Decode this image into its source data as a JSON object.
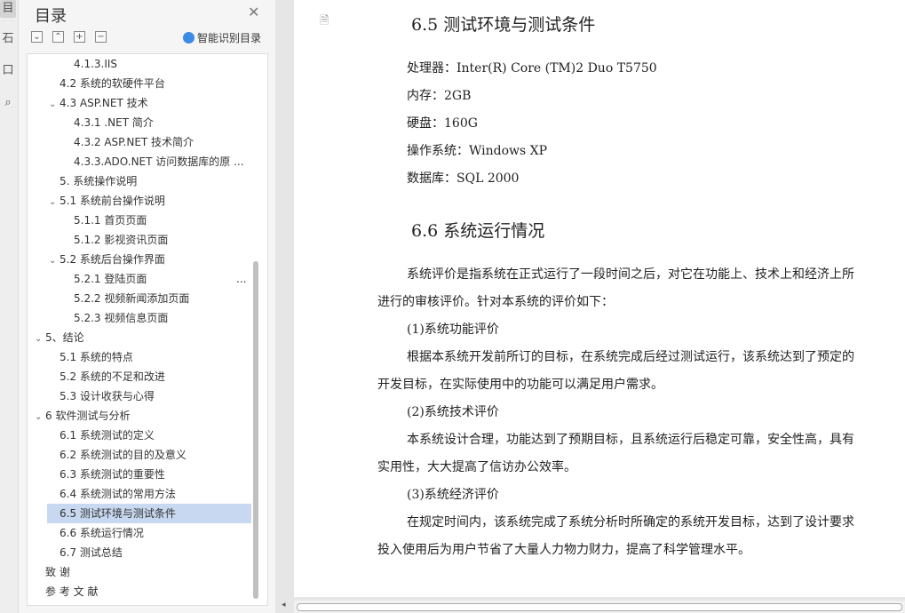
{
  "rail": {
    "items": [
      {
        "glyph": "目",
        "active": true
      },
      {
        "glyph": "石",
        "active": false
      },
      {
        "glyph": "口",
        "active": false
      },
      {
        "glyph": "⌕",
        "active": false
      }
    ]
  },
  "toc": {
    "title": "目录",
    "close_glyph": "✕",
    "smart_label": "智能识别目录",
    "tools": [
      "⌄",
      "⌃",
      "+",
      "−"
    ],
    "items": [
      {
        "label": "4.1.3.IIS",
        "level": 3,
        "chevron": ""
      },
      {
        "label": "4.2 系统的软硬件平台",
        "level": 2,
        "chevron": ""
      },
      {
        "label": "4.3 ASP.NET 技术",
        "level": 2,
        "chevron": "⌄"
      },
      {
        "label": "4.3.1 .NET 简介",
        "level": 3,
        "chevron": ""
      },
      {
        "label": "4.3.2 ASP.NET 技术简介",
        "level": 3,
        "chevron": ""
      },
      {
        "label": "4.3.3.ADO.NET 访问数据库的原 ...",
        "level": 3,
        "chevron": ""
      },
      {
        "label": "5.  系统操作说明",
        "level": 2,
        "chevron": ""
      },
      {
        "label": "5.1 系统前台操作说明",
        "level": 2,
        "chevron": "⌄"
      },
      {
        "label": "5.1.1 首页页面",
        "level": 3,
        "chevron": ""
      },
      {
        "label": "5.1.2 影视资讯页面",
        "level": 3,
        "chevron": ""
      },
      {
        "label": "5.2 系统后台操作界面",
        "level": 2,
        "chevron": "⌄"
      },
      {
        "label": "5.2.1 登陆页面",
        "level": 3,
        "chevron": "",
        "more": "..."
      },
      {
        "label": "5.2.2 视频新闻添加页面",
        "level": 3,
        "chevron": ""
      },
      {
        "label": "5.2.3 视频信息页面",
        "level": 3,
        "chevron": ""
      },
      {
        "label": "5、结论",
        "level": 1,
        "chevron": "⌄"
      },
      {
        "label": "5.1 系统的特点",
        "level": 2,
        "chevron": ""
      },
      {
        "label": "5.2 系统的不足和改进",
        "level": 2,
        "chevron": ""
      },
      {
        "label": "5.3 设计收获与心得",
        "level": 2,
        "chevron": ""
      },
      {
        "label": "6 软件测试与分析",
        "level": 1,
        "chevron": "⌄"
      },
      {
        "label": "6.1 系统测试的定义",
        "level": 2,
        "chevron": ""
      },
      {
        "label": "6.2 系统测试的目的及意义",
        "level": 2,
        "chevron": ""
      },
      {
        "label": "6.3 系统测试的重要性",
        "level": 2,
        "chevron": ""
      },
      {
        "label": "6.4 系统测试的常用方法",
        "level": 2,
        "chevron": ""
      },
      {
        "label": "6.5 测试环境与测试条件",
        "level": 2,
        "chevron": "",
        "selected": true
      },
      {
        "label": "6.6 系统运行情况",
        "level": 2,
        "chevron": ""
      },
      {
        "label": "6.7 测试总结",
        "level": 2,
        "chevron": ""
      },
      {
        "label": "致    谢",
        "level": 1,
        "chevron": ""
      },
      {
        "label": "参 考 文 献",
        "level": 1,
        "chevron": ""
      }
    ]
  },
  "document": {
    "icon_glyph": "🗎",
    "heading1": "6.5 测试环境与测试条件",
    "specs": [
      "处理器：Inter(R) Core (TM)2 Duo T5750",
      "内存：2GB",
      "硬盘：160G",
      "操作系统：Windows XP",
      "数据库：SQL 2000"
    ],
    "heading2": "6.6 系统运行情况",
    "body": [
      {
        "text": "系统评价是指系统在正式运行了一段时间之后，对它在功能上、技术上和经济上所",
        "indent": true
      },
      {
        "text": "进行的审核评价。针对本系统的评价如下：",
        "indent": false
      },
      {
        "text": "(1)系统功能评价",
        "indent": true
      },
      {
        "text": "根据本系统开发前所订的目标，在系统完成后经过测试运行，该系统达到了预定的",
        "indent": true
      },
      {
        "text": "开发目标，在实际使用中的功能可以满足用户需求。",
        "indent": false
      },
      {
        "text": "(2)系统技术评价",
        "indent": true
      },
      {
        "text": "本系统设计合理，功能达到了预期目标，且系统运行后稳定可靠，安全性高，具有",
        "indent": true
      },
      {
        "text": "实用性，大大提高了信访办公效率。",
        "indent": false
      },
      {
        "text": "(3)系统经济评价",
        "indent": true
      },
      {
        "text": "在规定时间内，该系统完成了系统分析时所确定的系统开发目标，达到了设计要求",
        "indent": true
      },
      {
        "text": "投入使用后为用户节省了大量人力物力财力，提高了科学管理水平。",
        "indent": false
      }
    ]
  }
}
